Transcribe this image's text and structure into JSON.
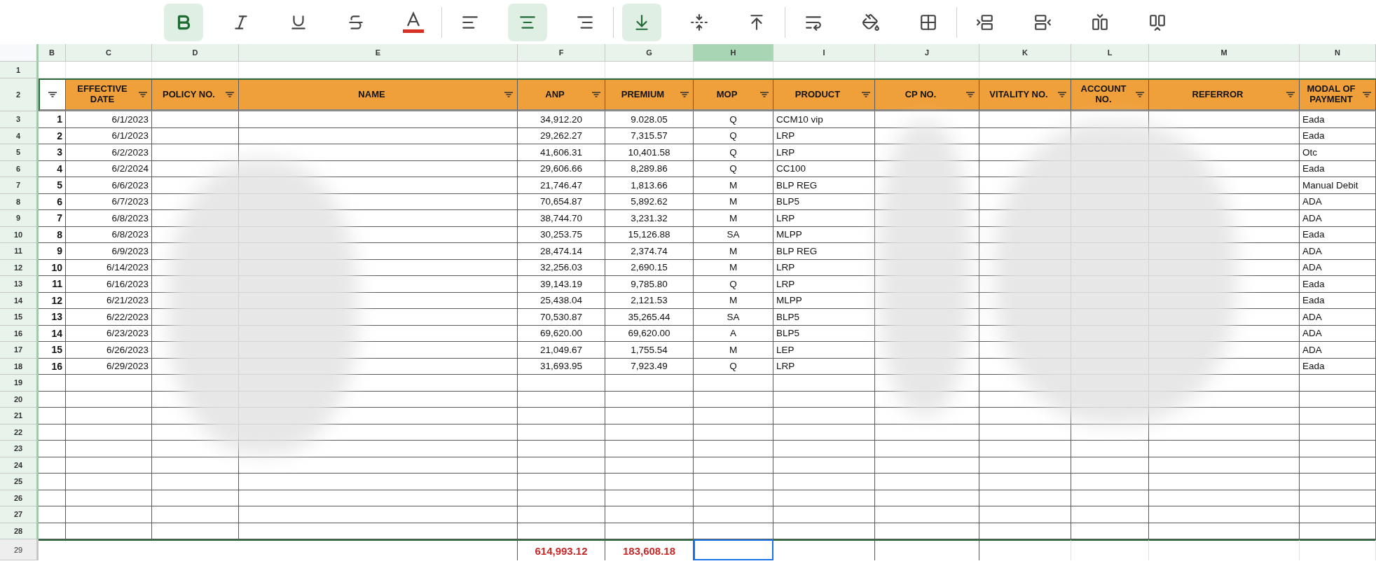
{
  "toolbar": [
    {
      "kind": "bold",
      "selected": true
    },
    {
      "kind": "italic",
      "selected": false
    },
    {
      "kind": "underline",
      "selected": false
    },
    {
      "kind": "strikethrough",
      "selected": false
    },
    {
      "kind": "text-color",
      "selected": false,
      "color": "#d93025"
    },
    {
      "kind": "separator"
    },
    {
      "kind": "align-left",
      "selected": false
    },
    {
      "kind": "align-center",
      "selected": true
    },
    {
      "kind": "align-right",
      "selected": false
    },
    {
      "kind": "separator"
    },
    {
      "kind": "valign-bottom",
      "selected": true
    },
    {
      "kind": "valign-middle",
      "selected": false
    },
    {
      "kind": "valign-top",
      "selected": false
    },
    {
      "kind": "separator"
    },
    {
      "kind": "wrap",
      "selected": false
    },
    {
      "kind": "fill-color",
      "selected": false
    },
    {
      "kind": "borders",
      "selected": false
    },
    {
      "kind": "separator"
    },
    {
      "kind": "insert-row-below",
      "selected": false
    },
    {
      "kind": "insert-row-above",
      "selected": false
    },
    {
      "kind": "insert-col-right",
      "selected": false
    },
    {
      "kind": "insert-col-left",
      "selected": false
    }
  ],
  "column_letters": [
    {
      "label": "B",
      "selected": false
    },
    {
      "label": "C",
      "selected": false
    },
    {
      "label": "D",
      "selected": false
    },
    {
      "label": "E",
      "selected": false
    },
    {
      "label": "F",
      "selected": false
    },
    {
      "label": "G",
      "selected": false
    },
    {
      "label": "H",
      "selected": true
    },
    {
      "label": "I",
      "selected": false
    },
    {
      "label": "J",
      "selected": false
    },
    {
      "label": "K",
      "selected": false
    },
    {
      "label": "L",
      "selected": false
    },
    {
      "label": "M",
      "selected": false
    },
    {
      "label": "N",
      "selected": false
    }
  ],
  "row_numbers": [
    {
      "label": "1",
      "highlighted": true
    },
    {
      "label": "2",
      "highlighted": true
    },
    {
      "label": "3",
      "highlighted": true
    },
    {
      "label": "4",
      "highlighted": true
    },
    {
      "label": "5",
      "highlighted": true
    },
    {
      "label": "6",
      "highlighted": true
    },
    {
      "label": "7",
      "highlighted": true
    },
    {
      "label": "8",
      "highlighted": true
    },
    {
      "label": "9",
      "highlighted": true
    },
    {
      "label": "10",
      "highlighted": true
    },
    {
      "label": "11",
      "highlighted": true
    },
    {
      "label": "12",
      "highlighted": true
    },
    {
      "label": "13",
      "highlighted": true
    },
    {
      "label": "14",
      "highlighted": true
    },
    {
      "label": "15",
      "highlighted": true
    },
    {
      "label": "16",
      "highlighted": true
    },
    {
      "label": "17",
      "highlighted": true
    },
    {
      "label": "18",
      "highlighted": true
    },
    {
      "label": "19",
      "highlighted": true
    },
    {
      "label": "20",
      "highlighted": true
    },
    {
      "label": "21",
      "highlighted": true
    },
    {
      "label": "22",
      "highlighted": true
    },
    {
      "label": "23",
      "highlighted": true
    },
    {
      "label": "24",
      "highlighted": true
    },
    {
      "label": "25",
      "highlighted": true
    },
    {
      "label": "26",
      "highlighted": true
    },
    {
      "label": "27",
      "highlighted": true
    },
    {
      "label": "28",
      "highlighted": true
    },
    {
      "label": "29",
      "highlighted": false
    }
  ],
  "headers": [
    "EFFECTIVE DATE",
    "POLICY NO.",
    "NAME",
    "ANP",
    "PREMIUM",
    "MOP",
    "PRODUCT",
    "CP NO.",
    "VITALITY NO.",
    "ACCOUNT NO.",
    "REFERROR",
    "MODAL OF PAYMENT"
  ],
  "rows": [
    {
      "no": "1",
      "date": "6/1/2023",
      "anp": "34,912.20",
      "premium": "9.028.05",
      "mop": "Q",
      "product": "CCM10 vip",
      "payment": "Eada"
    },
    {
      "no": "2",
      "date": "6/1/2023",
      "anp": "29,262.27",
      "premium": "7,315.57",
      "mop": "Q",
      "product": "LRP",
      "payment": "Eada"
    },
    {
      "no": "3",
      "date": "6/2/2023",
      "anp": "41,606.31",
      "premium": "10,401.58",
      "mop": "Q",
      "product": "LRP",
      "payment": "Otc"
    },
    {
      "no": "4",
      "date": "6/2/2024",
      "anp": "29,606.66",
      "premium": "8,289.86",
      "mop": "Q",
      "product": "CC100",
      "payment": "Eada"
    },
    {
      "no": "5",
      "date": "6/6/2023",
      "anp": "21,746.47",
      "premium": "1,813.66",
      "mop": "M",
      "product": "BLP REG",
      "payment": "Manual Debit"
    },
    {
      "no": "6",
      "date": "6/7/2023",
      "anp": "70,654.87",
      "premium": "5,892.62",
      "mop": "M",
      "product": "BLP5",
      "payment": "ADA"
    },
    {
      "no": "7",
      "date": "6/8/2023",
      "anp": "38,744.70",
      "premium": "3,231.32",
      "mop": "M",
      "product": "LRP",
      "payment": "ADA"
    },
    {
      "no": "8",
      "date": "6/8/2023",
      "anp": "30,253.75",
      "premium": "15,126.88",
      "mop": "SA",
      "product": "MLPP",
      "payment": "Eada"
    },
    {
      "no": "9",
      "date": "6/9/2023",
      "anp": "28,474.14",
      "premium": "2,374.74",
      "mop": "M",
      "product": "BLP REG",
      "payment": "ADA"
    },
    {
      "no": "10",
      "date": "6/14/2023",
      "anp": "32,256.03",
      "premium": "2,690.15",
      "mop": "M",
      "product": "LRP",
      "payment": "ADA"
    },
    {
      "no": "11",
      "date": "6/16/2023",
      "anp": "39,143.19",
      "premium": "9,785.80",
      "mop": "Q",
      "product": "LRP",
      "payment": "Eada"
    },
    {
      "no": "12",
      "date": "6/21/2023",
      "anp": "25,438.04",
      "premium": "2,121.53",
      "mop": "M",
      "product": "MLPP",
      "payment": "Eada"
    },
    {
      "no": "13",
      "date": "6/22/2023",
      "anp": "70,530.87",
      "premium": "35,265.44",
      "mop": "SA",
      "product": "BLP5",
      "payment": "ADA"
    },
    {
      "no": "14",
      "date": "6/23/2023",
      "anp": "69,620.00",
      "premium": "69,620.00",
      "mop": "A",
      "product": "BLP5",
      "payment": "ADA"
    },
    {
      "no": "15",
      "date": "6/26/2023",
      "anp": "21,049.67",
      "premium": "1,755.54",
      "mop": "M",
      "product": "LEP",
      "payment": "ADA"
    },
    {
      "no": "16",
      "date": "6/29/2023",
      "anp": "31,693.95",
      "premium": "7,923.49",
      "mop": "Q",
      "product": "LRP",
      "payment": "Eada"
    }
  ],
  "totals": {
    "anp": "614,993.12",
    "premium": "183,608.18",
    "mop_selected": true
  }
}
